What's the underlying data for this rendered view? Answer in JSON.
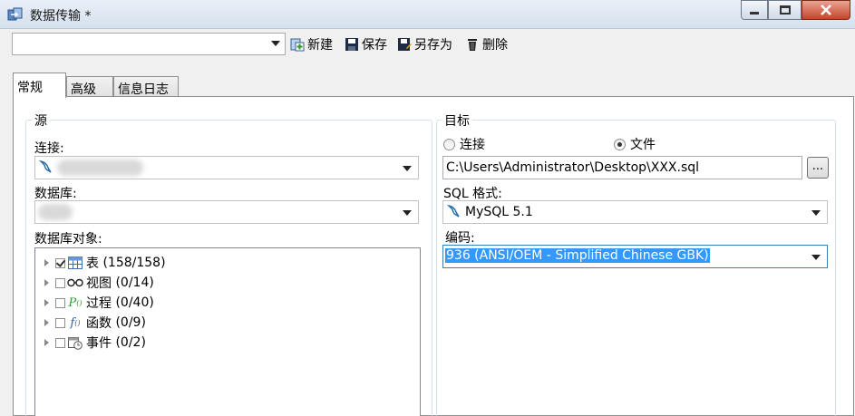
{
  "window": {
    "title": "数据传输 *"
  },
  "toolbar": {
    "profile_value": "",
    "new_label": "新建",
    "save_label": "保存",
    "save_as_label": "另存为",
    "delete_label": "删除"
  },
  "tabs": [
    {
      "label": "常规"
    },
    {
      "label": "高级"
    },
    {
      "label": "信息日志"
    }
  ],
  "source": {
    "title": "源",
    "connection_label": "连接:",
    "database_label": "数据库:",
    "objects_label": "数据库对象:",
    "tree": [
      {
        "label": "表",
        "count": "(158/158)",
        "checked": true,
        "icon": "table-icon"
      },
      {
        "label": "视图",
        "count": "(0/14)",
        "checked": false,
        "icon": "view-icon"
      },
      {
        "label": "过程",
        "count": "(0/40)",
        "checked": false,
        "icon": "procedure-icon"
      },
      {
        "label": "函数",
        "count": "(0/9)",
        "checked": false,
        "icon": "function-icon"
      },
      {
        "label": "事件",
        "count": "(0/2)",
        "checked": false,
        "icon": "event-icon"
      }
    ]
  },
  "target": {
    "title": "目标",
    "radio_connection": "连接",
    "radio_file": "文件",
    "selected": "file",
    "file_path": "C:\\Users\\Administrator\\Desktop\\XXX.sql",
    "browse_label": "...",
    "sql_format_label": "SQL 格式:",
    "sql_format_value": "MySQL 5.1",
    "encoding_label": "编码:",
    "encoding_value": "936 (ANSI/OEM - Simplified Chinese GBK)"
  }
}
